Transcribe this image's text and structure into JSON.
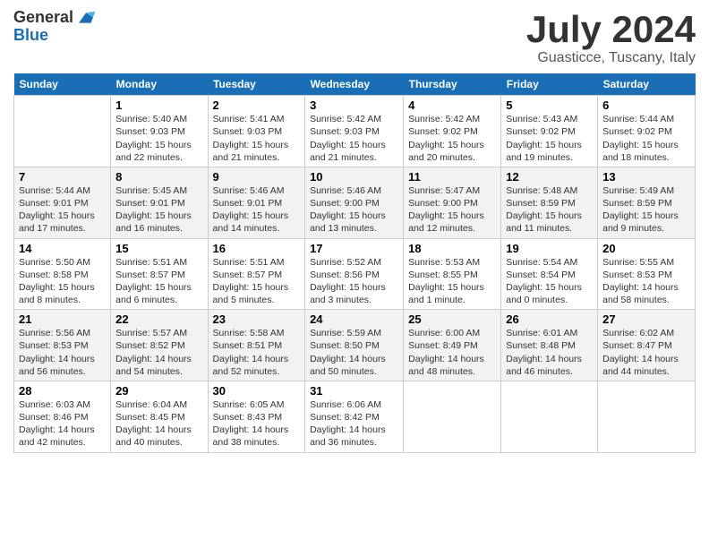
{
  "header": {
    "logo_general": "General",
    "logo_blue": "Blue",
    "month_year": "July 2024",
    "location": "Guasticce, Tuscany, Italy"
  },
  "days_of_week": [
    "Sunday",
    "Monday",
    "Tuesday",
    "Wednesday",
    "Thursday",
    "Friday",
    "Saturday"
  ],
  "weeks": [
    [
      {
        "day": "",
        "sunrise": "",
        "sunset": "",
        "daylight": ""
      },
      {
        "day": "1",
        "sunrise": "Sunrise: 5:40 AM",
        "sunset": "Sunset: 9:03 PM",
        "daylight": "Daylight: 15 hours and 22 minutes."
      },
      {
        "day": "2",
        "sunrise": "Sunrise: 5:41 AM",
        "sunset": "Sunset: 9:03 PM",
        "daylight": "Daylight: 15 hours and 21 minutes."
      },
      {
        "day": "3",
        "sunrise": "Sunrise: 5:42 AM",
        "sunset": "Sunset: 9:03 PM",
        "daylight": "Daylight: 15 hours and 21 minutes."
      },
      {
        "day": "4",
        "sunrise": "Sunrise: 5:42 AM",
        "sunset": "Sunset: 9:02 PM",
        "daylight": "Daylight: 15 hours and 20 minutes."
      },
      {
        "day": "5",
        "sunrise": "Sunrise: 5:43 AM",
        "sunset": "Sunset: 9:02 PM",
        "daylight": "Daylight: 15 hours and 19 minutes."
      },
      {
        "day": "6",
        "sunrise": "Sunrise: 5:44 AM",
        "sunset": "Sunset: 9:02 PM",
        "daylight": "Daylight: 15 hours and 18 minutes."
      }
    ],
    [
      {
        "day": "7",
        "sunrise": "Sunrise: 5:44 AM",
        "sunset": "Sunset: 9:01 PM",
        "daylight": "Daylight: 15 hours and 17 minutes."
      },
      {
        "day": "8",
        "sunrise": "Sunrise: 5:45 AM",
        "sunset": "Sunset: 9:01 PM",
        "daylight": "Daylight: 15 hours and 16 minutes."
      },
      {
        "day": "9",
        "sunrise": "Sunrise: 5:46 AM",
        "sunset": "Sunset: 9:01 PM",
        "daylight": "Daylight: 15 hours and 14 minutes."
      },
      {
        "day": "10",
        "sunrise": "Sunrise: 5:46 AM",
        "sunset": "Sunset: 9:00 PM",
        "daylight": "Daylight: 15 hours and 13 minutes."
      },
      {
        "day": "11",
        "sunrise": "Sunrise: 5:47 AM",
        "sunset": "Sunset: 9:00 PM",
        "daylight": "Daylight: 15 hours and 12 minutes."
      },
      {
        "day": "12",
        "sunrise": "Sunrise: 5:48 AM",
        "sunset": "Sunset: 8:59 PM",
        "daylight": "Daylight: 15 hours and 11 minutes."
      },
      {
        "day": "13",
        "sunrise": "Sunrise: 5:49 AM",
        "sunset": "Sunset: 8:59 PM",
        "daylight": "Daylight: 15 hours and 9 minutes."
      }
    ],
    [
      {
        "day": "14",
        "sunrise": "Sunrise: 5:50 AM",
        "sunset": "Sunset: 8:58 PM",
        "daylight": "Daylight: 15 hours and 8 minutes."
      },
      {
        "day": "15",
        "sunrise": "Sunrise: 5:51 AM",
        "sunset": "Sunset: 8:57 PM",
        "daylight": "Daylight: 15 hours and 6 minutes."
      },
      {
        "day": "16",
        "sunrise": "Sunrise: 5:51 AM",
        "sunset": "Sunset: 8:57 PM",
        "daylight": "Daylight: 15 hours and 5 minutes."
      },
      {
        "day": "17",
        "sunrise": "Sunrise: 5:52 AM",
        "sunset": "Sunset: 8:56 PM",
        "daylight": "Daylight: 15 hours and 3 minutes."
      },
      {
        "day": "18",
        "sunrise": "Sunrise: 5:53 AM",
        "sunset": "Sunset: 8:55 PM",
        "daylight": "Daylight: 15 hours and 1 minute."
      },
      {
        "day": "19",
        "sunrise": "Sunrise: 5:54 AM",
        "sunset": "Sunset: 8:54 PM",
        "daylight": "Daylight: 15 hours and 0 minutes."
      },
      {
        "day": "20",
        "sunrise": "Sunrise: 5:55 AM",
        "sunset": "Sunset: 8:53 PM",
        "daylight": "Daylight: 14 hours and 58 minutes."
      }
    ],
    [
      {
        "day": "21",
        "sunrise": "Sunrise: 5:56 AM",
        "sunset": "Sunset: 8:53 PM",
        "daylight": "Daylight: 14 hours and 56 minutes."
      },
      {
        "day": "22",
        "sunrise": "Sunrise: 5:57 AM",
        "sunset": "Sunset: 8:52 PM",
        "daylight": "Daylight: 14 hours and 54 minutes."
      },
      {
        "day": "23",
        "sunrise": "Sunrise: 5:58 AM",
        "sunset": "Sunset: 8:51 PM",
        "daylight": "Daylight: 14 hours and 52 minutes."
      },
      {
        "day": "24",
        "sunrise": "Sunrise: 5:59 AM",
        "sunset": "Sunset: 8:50 PM",
        "daylight": "Daylight: 14 hours and 50 minutes."
      },
      {
        "day": "25",
        "sunrise": "Sunrise: 6:00 AM",
        "sunset": "Sunset: 8:49 PM",
        "daylight": "Daylight: 14 hours and 48 minutes."
      },
      {
        "day": "26",
        "sunrise": "Sunrise: 6:01 AM",
        "sunset": "Sunset: 8:48 PM",
        "daylight": "Daylight: 14 hours and 46 minutes."
      },
      {
        "day": "27",
        "sunrise": "Sunrise: 6:02 AM",
        "sunset": "Sunset: 8:47 PM",
        "daylight": "Daylight: 14 hours and 44 minutes."
      }
    ],
    [
      {
        "day": "28",
        "sunrise": "Sunrise: 6:03 AM",
        "sunset": "Sunset: 8:46 PM",
        "daylight": "Daylight: 14 hours and 42 minutes."
      },
      {
        "day": "29",
        "sunrise": "Sunrise: 6:04 AM",
        "sunset": "Sunset: 8:45 PM",
        "daylight": "Daylight: 14 hours and 40 minutes."
      },
      {
        "day": "30",
        "sunrise": "Sunrise: 6:05 AM",
        "sunset": "Sunset: 8:43 PM",
        "daylight": "Daylight: 14 hours and 38 minutes."
      },
      {
        "day": "31",
        "sunrise": "Sunrise: 6:06 AM",
        "sunset": "Sunset: 8:42 PM",
        "daylight": "Daylight: 14 hours and 36 minutes."
      },
      {
        "day": "",
        "sunrise": "",
        "sunset": "",
        "daylight": ""
      },
      {
        "day": "",
        "sunrise": "",
        "sunset": "",
        "daylight": ""
      },
      {
        "day": "",
        "sunrise": "",
        "sunset": "",
        "daylight": ""
      }
    ]
  ]
}
